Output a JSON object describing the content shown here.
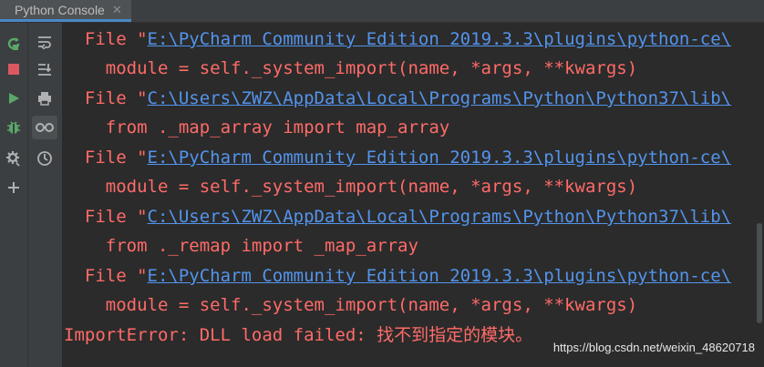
{
  "tab": {
    "title": "Python Console",
    "close": "✕"
  },
  "left_toolbar": [
    {
      "name": "rerun-icon",
      "color": "#59a869"
    },
    {
      "name": "stop-icon",
      "color": "#db5860"
    },
    {
      "name": "run-icon",
      "color": "#59a869"
    },
    {
      "name": "debug-icon",
      "color": "#59a869"
    },
    {
      "name": "settings-icon",
      "color": "#afb1b3"
    },
    {
      "name": "add-icon",
      "color": "#afb1b3"
    }
  ],
  "right_toolbar": [
    {
      "name": "soft-wrap-icon"
    },
    {
      "name": "scroll-to-end-icon"
    },
    {
      "name": "print-icon"
    },
    {
      "name": "show-variables-icon"
    },
    {
      "name": "history-icon"
    }
  ],
  "console": {
    "lines": [
      {
        "prefix": "  File \"",
        "link": "E:\\PyCharm Community Edition 2019.3.3\\plugins\\python-ce\\",
        "suffix": ""
      },
      {
        "prefix": "    module = self._system_import(name, *args, **kwargs)",
        "link": "",
        "suffix": ""
      },
      {
        "prefix": "  File \"",
        "link": "C:\\Users\\ZWZ\\AppData\\Local\\Programs\\Python\\Python37\\lib\\",
        "suffix": ""
      },
      {
        "prefix": "    from ._map_array import map_array",
        "link": "",
        "suffix": ""
      },
      {
        "prefix": "  File \"",
        "link": "E:\\PyCharm Community Edition 2019.3.3\\plugins\\python-ce\\",
        "suffix": ""
      },
      {
        "prefix": "    module = self._system_import(name, *args, **kwargs)",
        "link": "",
        "suffix": ""
      },
      {
        "prefix": "  File \"",
        "link": "C:\\Users\\ZWZ\\AppData\\Local\\Programs\\Python\\Python37\\lib\\",
        "suffix": ""
      },
      {
        "prefix": "    from ._remap import _map_array",
        "link": "",
        "suffix": ""
      },
      {
        "prefix": "  File \"",
        "link": "E:\\PyCharm Community Edition 2019.3.3\\plugins\\python-ce\\",
        "suffix": ""
      },
      {
        "prefix": "    module = self._system_import(name, *args, **kwargs)",
        "link": "",
        "suffix": ""
      },
      {
        "prefix": "ImportError: DLL load failed: 找不到指定的模块。",
        "link": "",
        "suffix": ""
      }
    ]
  },
  "watermark": "https://blog.csdn.net/weixin_48620718",
  "colors": {
    "error": "#ff6b68",
    "link": "#5394ec",
    "background": "#2b2b2b",
    "toolbar": "#3c3f41"
  }
}
